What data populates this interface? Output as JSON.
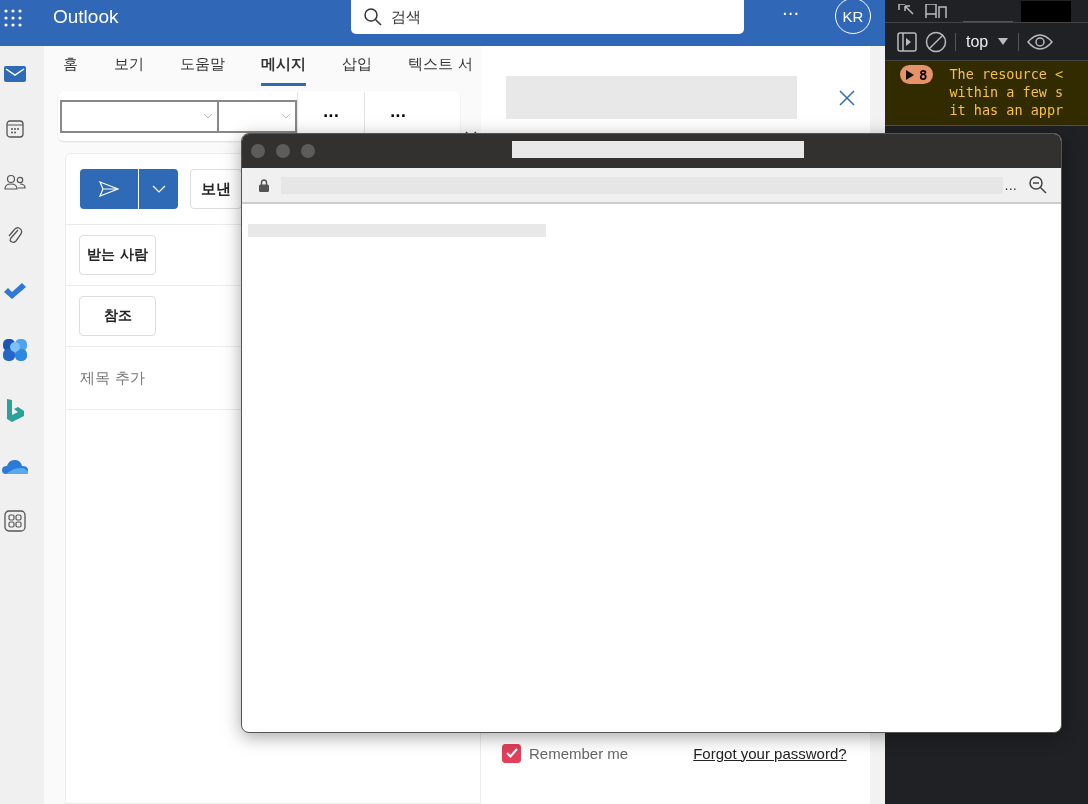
{
  "header": {
    "title": "Outlook",
    "search": {
      "placeholder": "검색"
    },
    "more": "···",
    "avatar": "KR"
  },
  "tabs": [
    {
      "label": "홈",
      "selected": false
    },
    {
      "label": "보기",
      "selected": false
    },
    {
      "label": "도움말",
      "selected": false
    },
    {
      "label": "메시지",
      "selected": true
    },
    {
      "label": "삽입",
      "selected": false
    },
    {
      "label": "텍스트 서",
      "selected": false
    }
  ],
  "ribbon": {
    "more_buttons": [
      "···",
      "···"
    ]
  },
  "compose": {
    "partial_button": "보낸",
    "recipients": [
      "받는 사람",
      "참조"
    ],
    "subject": {
      "placeholder": "제목 추가"
    }
  },
  "side_panel": {
    "remember": {
      "label": "Remember me",
      "checked": true
    },
    "forgot_link": "Forgot your password?"
  },
  "popup": {
    "menu": "..."
  },
  "devtools": {
    "tabs": [
      {
        "selected": false
      },
      {
        "selected": true
      }
    ],
    "context": "top",
    "message": {
      "count": "8",
      "lines": [
        "The resource <",
        "within a few s",
        "it has an appr"
      ]
    }
  }
}
